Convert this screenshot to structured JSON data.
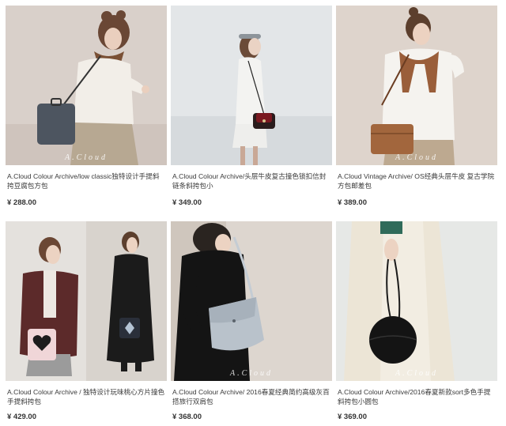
{
  "products": [
    {
      "title": "A.Cloud Colour Archive/low classic独特设计手提斜挎豆腐包方包",
      "price": "¥ 288.00",
      "watermark": "A.Cloud"
    },
    {
      "title": "A.Cloud Colour Archive/头层牛皮复古撞色锁扣信封链条斜挎包小",
      "price": "¥ 349.00",
      "watermark": ""
    },
    {
      "title": "A.Cloud Vintage Archive/ OS经典头层牛皮 复古学院方包邮差包",
      "price": "¥ 389.00",
      "watermark": "A.Cloud"
    },
    {
      "title": "A.Cloud Colour Archive / 独特设计玩味桃心方片撞色手提斜挎包",
      "price": "¥ 429.00",
      "watermark": ""
    },
    {
      "title": "A.Cloud Colour Archive/ 2016春夏经典简约高级灰百搭旅行双肩包",
      "price": "¥ 368.00",
      "watermark": "A.Cloud"
    },
    {
      "title": "A.Cloud Colour Archive/2016春夏新款sort多色手提斜挎包小圆包",
      "price": "¥ 369.00",
      "watermark": "A.Cloud"
    }
  ]
}
